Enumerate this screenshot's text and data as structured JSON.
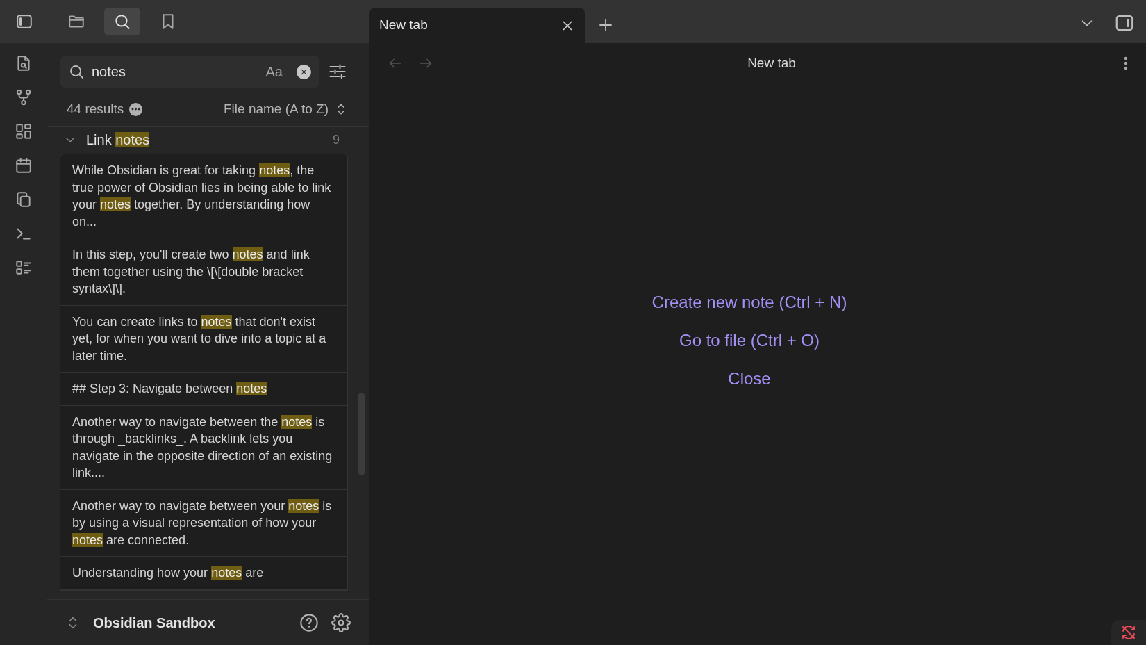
{
  "sidebar_toggle": {
    "on": true
  },
  "sidebar_tabs": [
    {
      "kind": "files",
      "selected": false
    },
    {
      "kind": "search",
      "selected": true
    },
    {
      "kind": "bookmarks",
      "selected": false
    }
  ],
  "tabs": [
    {
      "label": "New tab",
      "selected": true
    }
  ],
  "ribbon": [
    {
      "kind": "file-search"
    },
    {
      "kind": "graph"
    },
    {
      "kind": "grid"
    },
    {
      "kind": "calendar"
    },
    {
      "kind": "copy"
    },
    {
      "kind": "terminal"
    },
    {
      "kind": "list"
    }
  ],
  "search": {
    "value": "notes",
    "match_case_label": "Aa"
  },
  "results": {
    "count": "44 results",
    "sort": "File name (A to Z)"
  },
  "groups": [
    {
      "title": "Link **notes**",
      "count": "9",
      "expanded": true,
      "matches": [
        "While Obsidian is great for taking **notes**, the true power of Obsidian lies in being able to link your **notes** together. By understanding how on...",
        "In this step, you'll create two **notes** and link them together using the \\[\\[double bracket syntax\\]\\].",
        "You can create links to **notes** that don't exist yet, for when you want to dive into a topic at a later time.",
        "## Step 3: Navigate between **notes**",
        "Another way to navigate between the **notes** is through _backlinks_. A backlink lets you navigate in the opposite direction of an existing link....",
        "Another way to navigate between your **notes** is by using a visual representation of how your **notes** are connected.",
        "Understanding how your **notes** are"
      ]
    }
  ],
  "vault": {
    "name": "Obsidian Sandbox"
  },
  "main": {
    "title": "New tab",
    "actions": [
      "Create new note (Ctrl + N)",
      "Go to file (Ctrl + O)",
      "Close"
    ]
  }
}
